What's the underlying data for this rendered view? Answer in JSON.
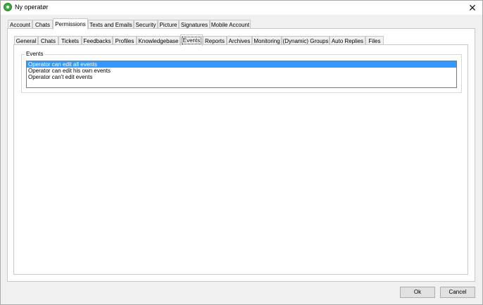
{
  "window": {
    "title": "Ny operatør",
    "close_symbol": "✕"
  },
  "main_tabs": [
    {
      "label": "Account",
      "active": false
    },
    {
      "label": "Chats",
      "active": false
    },
    {
      "label": "Permissions",
      "active": true
    },
    {
      "label": "Texts and Emails",
      "active": false
    },
    {
      "label": "Security",
      "active": false
    },
    {
      "label": "Picture",
      "active": false
    },
    {
      "label": "Signatures",
      "active": false
    },
    {
      "label": "Mobile Account",
      "active": false
    }
  ],
  "sub_tabs": [
    {
      "label": "General",
      "active": false
    },
    {
      "label": "Chats",
      "active": false
    },
    {
      "label": "Tickets",
      "active": false
    },
    {
      "label": "Feedbacks",
      "active": false
    },
    {
      "label": "Profiles",
      "active": false
    },
    {
      "label": "Knowledgebase",
      "active": false
    },
    {
      "label": "Events",
      "active": true
    },
    {
      "label": "Reports",
      "active": false
    },
    {
      "label": "Archives",
      "active": false
    },
    {
      "label": "Monitoring",
      "active": false
    },
    {
      "label": "(Dynamic) Groups",
      "active": false
    },
    {
      "label": "Auto Replies",
      "active": false
    },
    {
      "label": "Files",
      "active": false
    }
  ],
  "events_group": {
    "label": "Events",
    "options": [
      {
        "label": "Operator can edit all events",
        "selected": true
      },
      {
        "label": "Operator can edit his own events",
        "selected": false
      },
      {
        "label": "Operator can't edit events",
        "selected": false
      }
    ]
  },
  "buttons": {
    "ok": "Ok",
    "cancel": "Cancel"
  },
  "colors": {
    "selection": "#3399ff",
    "app_icon": "#3faa3f"
  }
}
